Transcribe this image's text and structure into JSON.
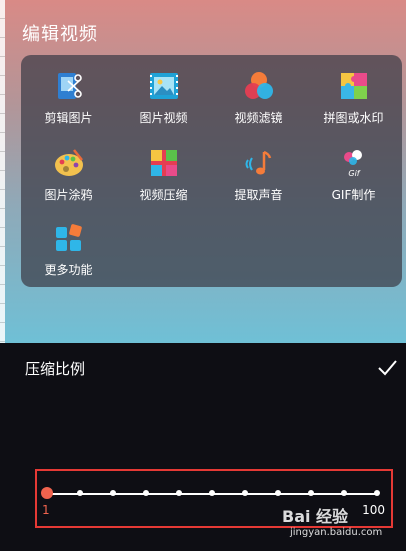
{
  "header": {
    "title": "编辑视频"
  },
  "tools": [
    {
      "label": "剪辑图片",
      "icon": "cut-image-icon"
    },
    {
      "label": "图片视频",
      "icon": "image-video-icon"
    },
    {
      "label": "视频滤镜",
      "icon": "video-filter-icon"
    },
    {
      "label": "拼图或水印",
      "icon": "puzzle-watermark-icon"
    },
    {
      "label": "图片涂鸦",
      "icon": "palette-icon"
    },
    {
      "label": "视频压缩",
      "icon": "compress-icon"
    },
    {
      "label": "提取声音",
      "icon": "music-note-icon"
    },
    {
      "label": "GIF制作",
      "icon": "gif-icon"
    },
    {
      "label": "更多功能",
      "icon": "more-icon"
    }
  ],
  "compress": {
    "label": "压缩比例",
    "min": "1",
    "max": "100",
    "value": 1,
    "tick_count": 11
  },
  "watermark": {
    "brand": "Bai 经验",
    "site": "jingyan.baidu.com"
  },
  "colors": {
    "accent": "#f0634e",
    "highlight_box": "#e53935"
  }
}
